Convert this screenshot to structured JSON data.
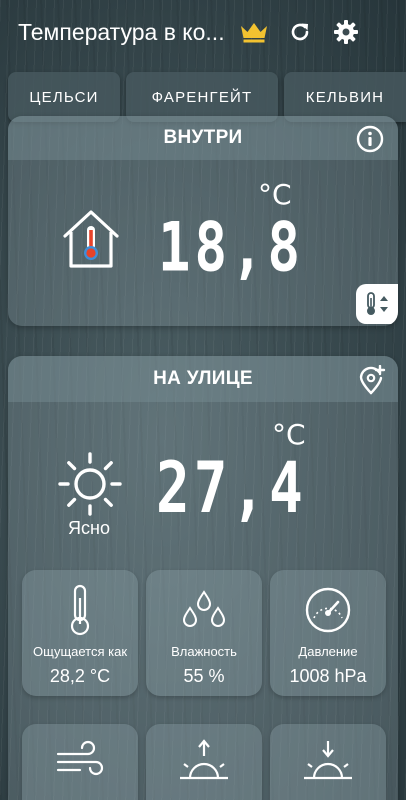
{
  "header": {
    "title": "Температура в ко..."
  },
  "unit_tabs": [
    "ЦЕЛЬСИ",
    "ФАРЕНГЕЙТ",
    "КЕЛЬВИН"
  ],
  "inside": {
    "title": "ВНУТРИ",
    "value": "18,8",
    "unit": "°C",
    "icon": "house-thermometer-icon"
  },
  "outside": {
    "title": "НА УЛИЦЕ",
    "value": "27,4",
    "unit": "°C",
    "condition": "Ясно",
    "icon": "sun-icon"
  },
  "details": [
    {
      "label": "Ощущается как",
      "value": "28,2 °C",
      "icon": "thermometer-icon"
    },
    {
      "label": "Влажность",
      "value": "55 %",
      "icon": "drops-icon"
    },
    {
      "label": "Давление",
      "value": "1008 hPa",
      "icon": "gauge-icon"
    }
  ],
  "bottom_details": [
    {
      "label": "",
      "icon": "wind-icon"
    },
    {
      "label": "",
      "icon": "sunrise-icon"
    },
    {
      "label": "",
      "icon": "sunset-icon"
    }
  ],
  "colors": {
    "crown": "#f2c230",
    "thermo_red": "#e8432a",
    "thermo_blue": "#3f8ed8"
  }
}
